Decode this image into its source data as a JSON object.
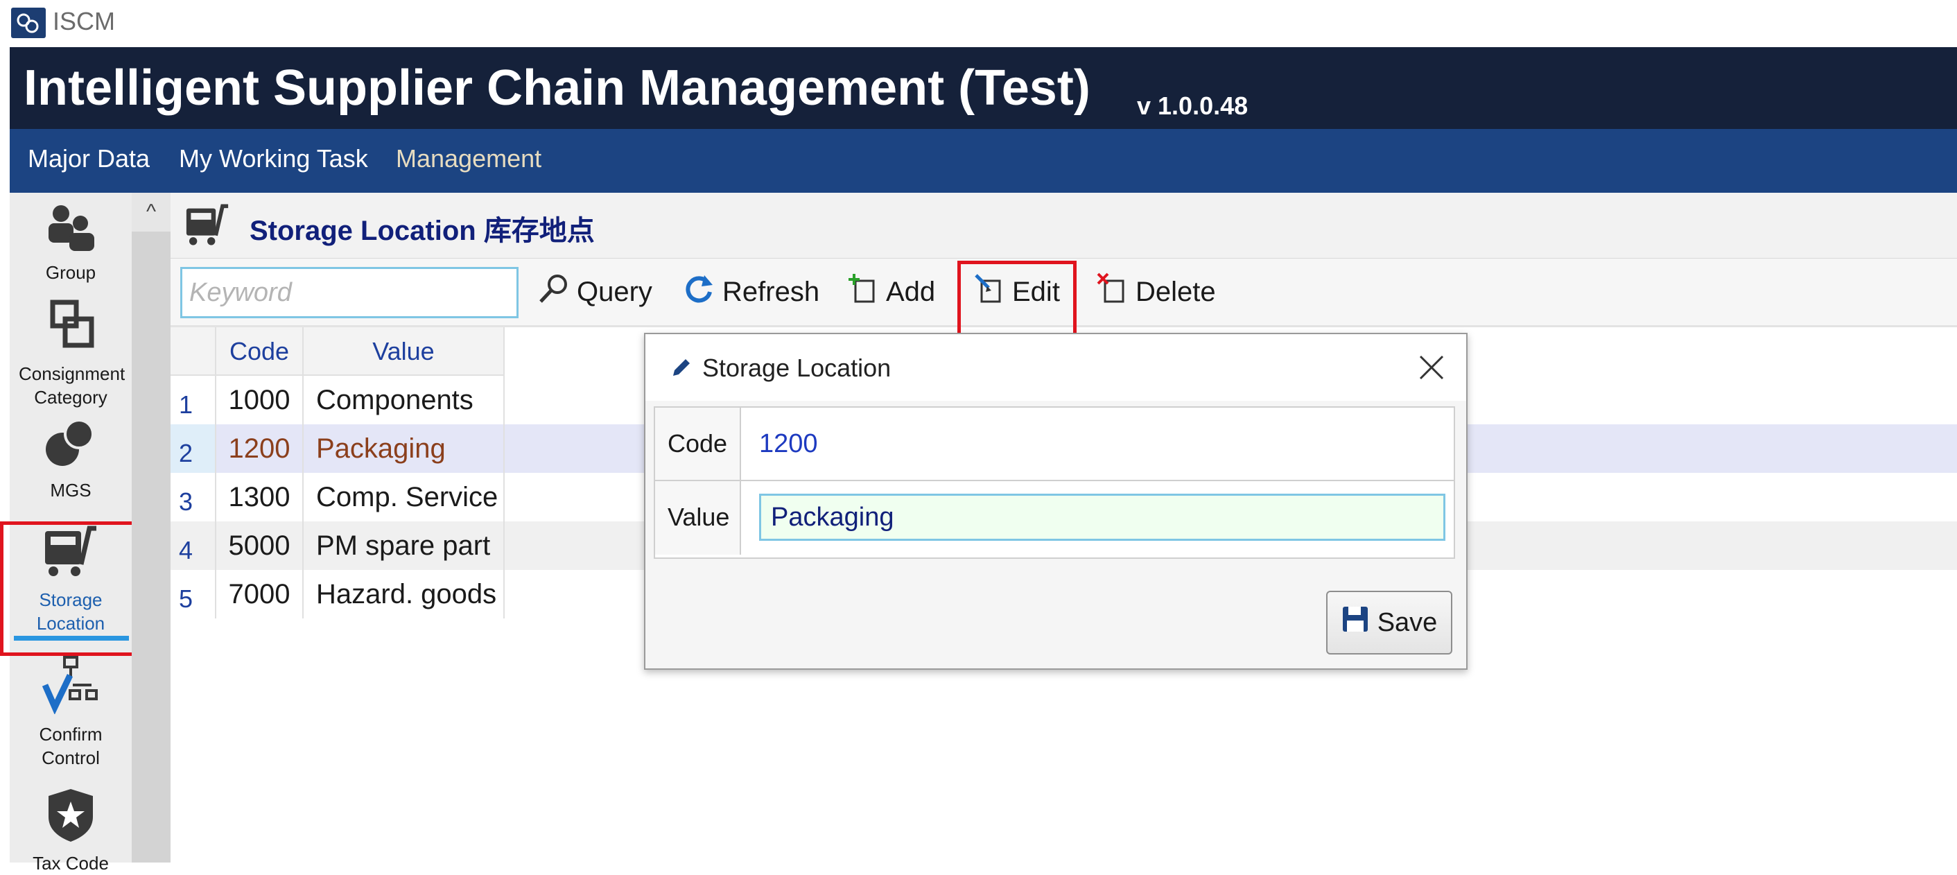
{
  "window": {
    "app_name": "ISCM"
  },
  "header": {
    "title": "Intelligent Supplier Chain Management (Test)",
    "version": "v 1.0.0.48"
  },
  "menu": [
    {
      "label": "Major Data"
    },
    {
      "label": "My Working Task"
    },
    {
      "label": "Management"
    }
  ],
  "sidebar": {
    "items": [
      {
        "label": "Group",
        "icon": "group-icon"
      },
      {
        "label": "Consignment Category",
        "icon": "consignment-icon"
      },
      {
        "label": "MGS",
        "icon": "mgs-icon"
      },
      {
        "label": "Storage Location",
        "icon": "cart-icon",
        "active": true
      },
      {
        "label": "Confirm Control",
        "icon": "confirm-control-icon"
      },
      {
        "label": "Tax Code",
        "icon": "tax-shield-icon"
      }
    ],
    "scroll_up": "^"
  },
  "page": {
    "title": "Storage Location 库存地点"
  },
  "toolbar": {
    "search_placeholder": "Keyword",
    "query_label": "Query",
    "refresh_label": "Refresh",
    "add_label": "Add",
    "edit_label": "Edit",
    "delete_label": "Delete"
  },
  "grid": {
    "columns": [
      "Code",
      "Value"
    ],
    "rows": [
      {
        "num": "1",
        "code": "1000",
        "value": "Components"
      },
      {
        "num": "2",
        "code": "1200",
        "value": "Packaging"
      },
      {
        "num": "3",
        "code": "1300",
        "value": "Comp. Service"
      },
      {
        "num": "4",
        "code": "5000",
        "value": "PM spare part"
      },
      {
        "num": "5",
        "code": "7000",
        "value": "Hazard. goods"
      }
    ]
  },
  "dialog": {
    "title": "Storage Location",
    "code_label": "Code",
    "code_value": "1200",
    "value_label": "Value",
    "value_value": "Packaging",
    "save_label": "Save"
  },
  "colors": {
    "header_bg": "#15213a",
    "menu_bg": "#1c4482",
    "highlight": "#e0141e",
    "active_underline": "#2a96e0"
  }
}
